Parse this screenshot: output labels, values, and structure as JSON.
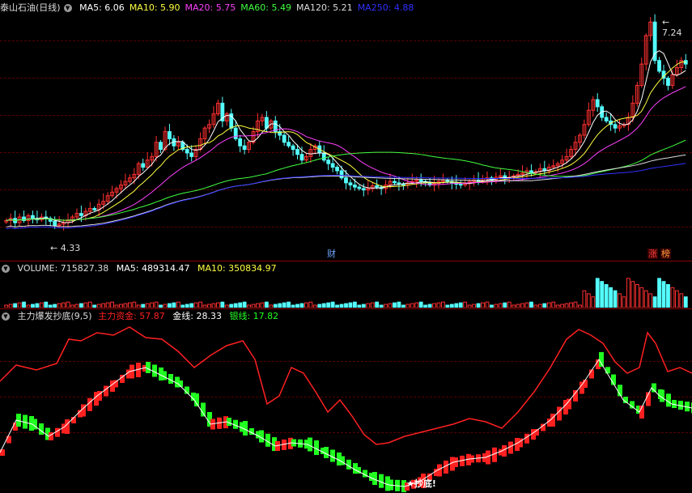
{
  "main_header": {
    "stock_name": "泰山石油(日线)",
    "ma": [
      {
        "label": "MA5: 6.06",
        "color": "#ffffff"
      },
      {
        "label": "MA10: 5.90",
        "color": "#ffff40"
      },
      {
        "label": "MA20: 5.75",
        "color": "#ff40ff"
      },
      {
        "label": "MA60: 5.49",
        "color": "#40ff40"
      },
      {
        "label": "MA120: 5.21",
        "color": "#dcdcdc"
      },
      {
        "label": "MA250: 4.88",
        "color": "#3030ff"
      }
    ]
  },
  "price": {
    "high_label": "7.24",
    "low_label": "4.33",
    "marker_cai": "财",
    "marker_zhang": "涨",
    "marker_bang": "榜"
  },
  "volume_header": {
    "label": "VOLUME: 715827.38",
    "ma5": "MA5: 489314.47",
    "ma10": "MA10: 350834.97"
  },
  "indicator_header": {
    "name": "主力爆发抄底(9,5)",
    "main_fund": "主力资金: 57.87",
    "gold": "金线: 28.33",
    "silver": "银线: 17.82"
  },
  "indicator": {
    "signal_label": "★抄底!"
  },
  "colors": {
    "up": "#ff3030",
    "down": "#54ffff",
    "fund_line": "#ff2020",
    "bull_bar": "#ff2020",
    "bear_bar": "#20ff20"
  },
  "chart_data": {
    "type": "candlestick",
    "price_range": [
      4.0,
      7.3
    ],
    "closes": [
      4.45,
      4.48,
      4.42,
      4.5,
      4.45,
      4.52,
      4.48,
      4.46,
      4.5,
      4.48,
      4.44,
      4.38,
      4.4,
      4.42,
      4.46,
      4.5,
      4.55,
      4.52,
      4.58,
      4.62,
      4.6,
      4.68,
      4.72,
      4.8,
      4.85,
      4.9,
      4.95,
      5.0,
      5.05,
      5.1,
      5.25,
      5.2,
      5.3,
      5.35,
      5.55,
      5.45,
      5.7,
      5.6,
      5.5,
      5.55,
      5.45,
      5.4,
      5.35,
      5.45,
      5.6,
      5.75,
      5.8,
      5.95,
      6.1,
      5.85,
      5.95,
      5.75,
      5.6,
      5.5,
      5.45,
      5.55,
      5.7,
      5.85,
      5.9,
      5.75,
      5.85,
      5.7,
      5.65,
      5.55,
      5.5,
      5.45,
      5.38,
      5.3,
      5.35,
      5.45,
      5.5,
      5.4,
      5.3,
      5.25,
      5.2,
      5.15,
      5.05,
      4.98,
      4.95,
      4.92,
      4.9,
      4.88,
      4.9,
      4.94,
      4.92,
      4.9,
      4.95,
      5.0,
      4.98,
      4.96,
      4.95,
      4.98,
      5.0,
      5.02,
      5.0,
      4.98,
      4.95,
      4.97,
      5.0,
      5.02,
      5.0,
      4.98,
      4.96,
      4.95,
      4.97,
      5.0,
      5.02,
      5.0,
      5.04,
      5.05,
      5.02,
      5.06,
      5.08,
      5.05,
      5.06,
      5.08,
      5.1,
      5.12,
      5.15,
      5.12,
      5.14,
      5.18,
      5.15,
      5.2,
      5.22,
      5.25,
      5.3,
      5.35,
      5.45,
      5.55,
      5.65,
      5.8,
      6.0,
      6.15,
      6.05,
      5.9,
      5.85,
      5.8,
      5.75,
      5.78,
      5.8,
      5.9,
      6.1,
      6.35,
      6.65,
      7.05,
      7.24,
      6.7,
      6.55,
      6.45,
      6.35,
      6.5,
      6.6,
      6.7,
      6.65
    ],
    "ma_series": [
      "MA5",
      "MA10",
      "MA20",
      "MA60",
      "MA120",
      "MA250"
    ]
  }
}
